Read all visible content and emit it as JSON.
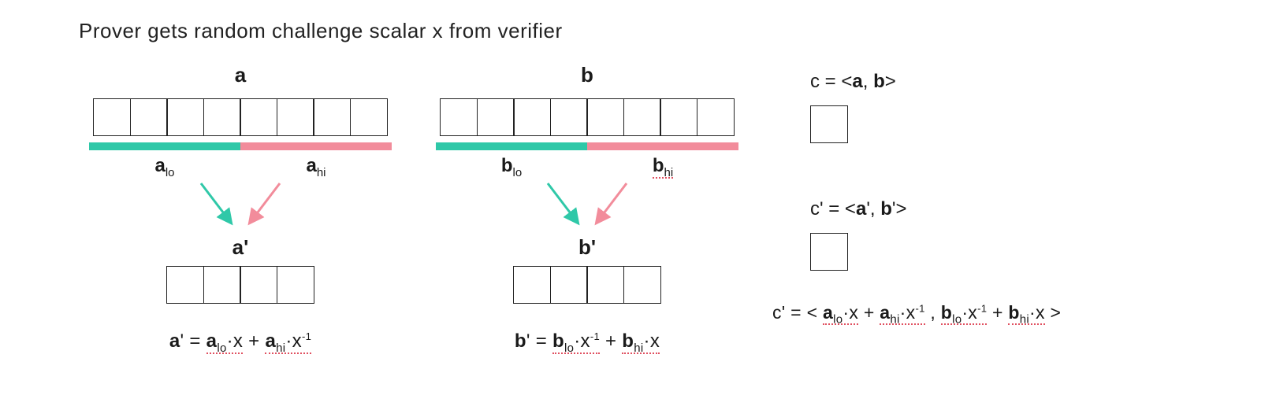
{
  "title": "Prover gets random challenge scalar x from verifier",
  "colors": {
    "teal": "#2fc8a8",
    "pink": "#f28c9b"
  },
  "vector_len": 8,
  "half_len": 4,
  "a": {
    "label": "a",
    "lo_label_vec": "a",
    "lo_label_sub": "lo",
    "hi_label_vec": "a",
    "hi_label_sub": "hi",
    "prime_label": "a'",
    "formula": {
      "lhs_vec": "a",
      "lhs_prime": "'",
      "t1_vec": "a",
      "t1_sub": "lo",
      "t1_op": "·x",
      "plus": " + ",
      "t2_vec": "a",
      "t2_sub": "hi",
      "t2_op": "·x",
      "t2_exp": "-1"
    }
  },
  "b": {
    "label": "b",
    "lo_label_vec": "b",
    "lo_label_sub": "lo",
    "hi_label_vec": "b",
    "hi_label_sub": "hi",
    "prime_label": "b'",
    "formula": {
      "lhs_vec": "b",
      "lhs_prime": "'",
      "t1_vec": "b",
      "t1_sub": "lo",
      "t1_op": "·x",
      "t1_exp": "-1",
      "plus": " + ",
      "t2_vec": "b",
      "t2_sub": "hi",
      "t2_op": "·x"
    }
  },
  "c": {
    "eq1_pre": "c = <",
    "eq1_a": "a",
    "eq1_sep": ", ",
    "eq1_b": "b",
    "eq1_post": ">",
    "eq2_pre": "c' = <",
    "eq2_a": "a",
    "eq2_ap": "'",
    "eq2_sep": ", ",
    "eq2_b": "b",
    "eq2_bp": "'",
    "eq2_post": ">",
    "formula": {
      "pre": "c' = < ",
      "a1_vec": "a",
      "a1_sub": "lo",
      "a1_op": "·x",
      "plus1": " + ",
      "a2_vec": "a",
      "a2_sub": "hi",
      "a2_op": "·x",
      "a2_exp": "-1",
      "sep": ", ",
      "b1_vec": "b",
      "b1_sub": "lo",
      "b1_op": "·x",
      "b1_exp": "-1",
      "plus2": " + ",
      "b2_vec": "b",
      "b2_sub": "hi",
      "b2_op": "·x",
      "post": " >"
    }
  }
}
